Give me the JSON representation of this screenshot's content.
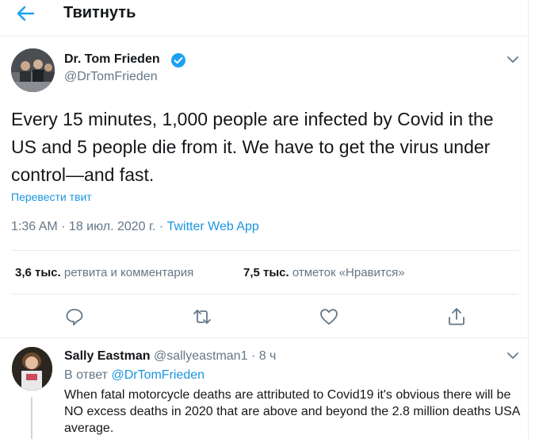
{
  "header": {
    "title": "Твитнуть"
  },
  "tweet": {
    "author_name": "Dr. Tom Frieden",
    "author_handle": "@DrTomFrieden",
    "text": "Every 15 minutes, 1,000 people are infected by Covid in the US and 5 people die from it. We have to get the virus under control—and fast.",
    "translate_label": "Перевести твит",
    "time": "1:36 AM",
    "date": "18 июл. 2020 г.",
    "separator": " · ",
    "source_app": "Twitter Web App",
    "retweets_count": "3,6 тыс.",
    "retweets_label": "ретвита и комментария",
    "likes_count": "7,5 тыс.",
    "likes_label": "отметок «Нравится»"
  },
  "reply": {
    "author_name": "Sally Eastman",
    "author_handle": "@sallyeastman1",
    "dot": " · ",
    "time_ago": "8 ч",
    "reply_prefix": "В ответ ",
    "reply_mention": "@DrTomFrieden",
    "text": "When fatal motorcycle deaths are attributed to Covid19 it's obvious there will be NO excess deaths in 2020 that are above and beyond the 2.8 million deaths USA average."
  },
  "colors": {
    "accent": "#1da1f2",
    "link": "#1b95e0",
    "muted": "#657786",
    "divider": "#e6ecf0"
  },
  "icons": {
    "back": "arrow-left-icon",
    "verified": "verified-badge-icon",
    "caret": "chevron-down-icon",
    "reply": "reply-icon",
    "retweet": "retweet-icon",
    "like": "heart-icon",
    "share": "share-icon"
  }
}
